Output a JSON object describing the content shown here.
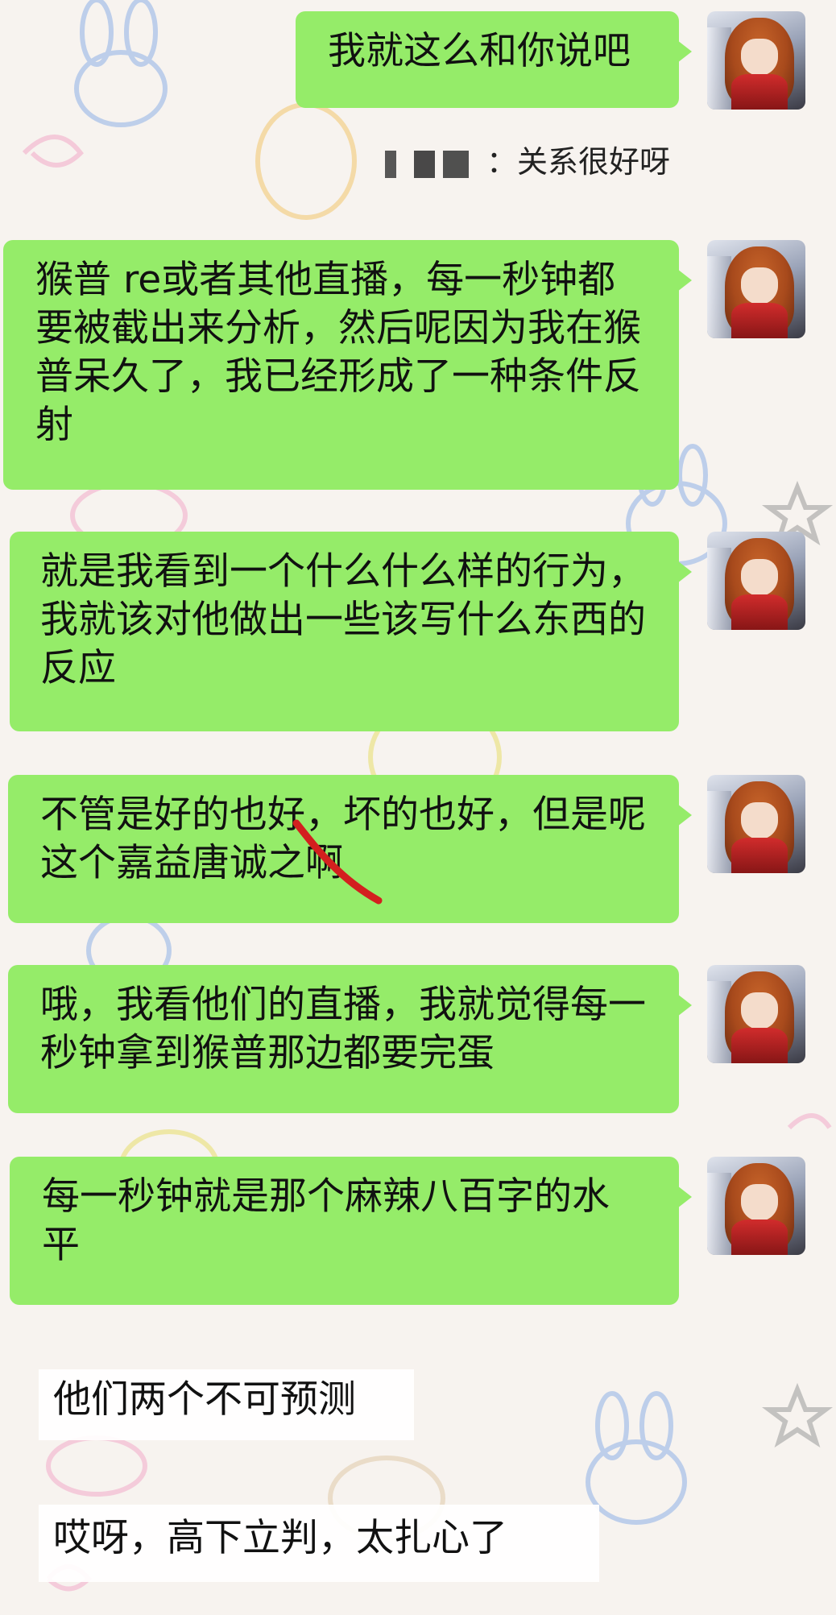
{
  "header_quote": {
    "author_hidden": "[redacted]",
    "text": "：关系很好呀"
  },
  "messages": [
    {
      "text": "我就这么和你说吧"
    },
    {
      "text": "猴普 re或者其他直播，每一秒钟都要被截出来分析，然后呢因为我在猴普呆久了，我已经形成了一种条件反射"
    },
    {
      "text": "就是我看到一个什么什么样的行为，我就该对他做出一些该写什么东西的反应"
    },
    {
      "text": "不管是好的也好，坏的也好，但是呢这个嘉益唐诚之啊"
    },
    {
      "text": "哦，我看他们的直播，我就觉得每一秒钟拿到猴普那边都要完蛋"
    },
    {
      "text": "每一秒钟就是那个麻辣八百字的水平"
    }
  ],
  "notes": [
    {
      "text": "他们两个不可预测"
    },
    {
      "text": "哎呀，高下立判，太扎心了"
    }
  ],
  "colors": {
    "bubble": "#95ec69",
    "background": "#f7f3ef",
    "pen_mark": "#d3201f"
  }
}
